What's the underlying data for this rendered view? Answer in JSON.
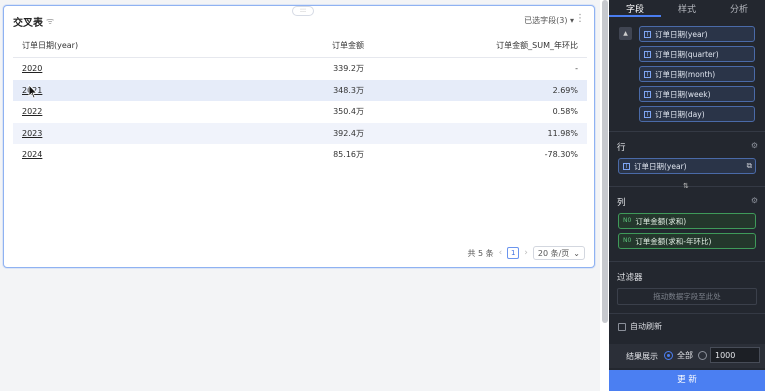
{
  "card": {
    "title": "交叉表",
    "title_icon": "ᯤ",
    "handle": ":::",
    "fields_selected": "已选字段(3) ▾",
    "more": "⋮",
    "columns": [
      "订单日期(year)",
      "订单金额",
      "订单金额_SUM_年环比"
    ],
    "rows": [
      [
        "2020",
        "339.2万",
        "-"
      ],
      [
        "2021",
        "348.3万",
        "2.69%"
      ],
      [
        "2022",
        "350.4万",
        "0.58%"
      ],
      [
        "2023",
        "392.4万",
        "11.98%"
      ],
      [
        "2024",
        "85.16万",
        "-78.30%"
      ]
    ],
    "pager": {
      "total": "共 5 条",
      "prev": "‹",
      "page": "1",
      "next": "›",
      "page_size": "20 条/页",
      "size_caret": "⌄"
    }
  },
  "panel": {
    "tabs": [
      "字段",
      "样式",
      "分析"
    ],
    "hierarchy_btn": "▲",
    "hierarchy": [
      "订单日期(year)",
      "订单日期(quarter)",
      "订单日期(month)",
      "订单日期(week)",
      "订单日期(day)"
    ],
    "row_label": "行",
    "row_field": "订单日期(year)",
    "swap": "⇅",
    "col_label": "列",
    "col_fields": [
      "订单金额(求和)",
      "订单金额(求和-年环比)"
    ],
    "measure_tag": "N0",
    "dim_tag": "T",
    "filter_label": "过滤器",
    "filter_placeholder": "拖动数据字段至此处",
    "auto_refresh": "自动刷新",
    "result_label": "结果展示",
    "result_all": "全部",
    "result_limit": "1000",
    "update": "更 新",
    "gear": "⚙",
    "cube": "⧉"
  },
  "colors": {
    "accent": "#4b7ff2",
    "panel_bg": "#23272f",
    "dimension_border": "#4a6aa8",
    "measure_border": "#3f9a5a"
  }
}
